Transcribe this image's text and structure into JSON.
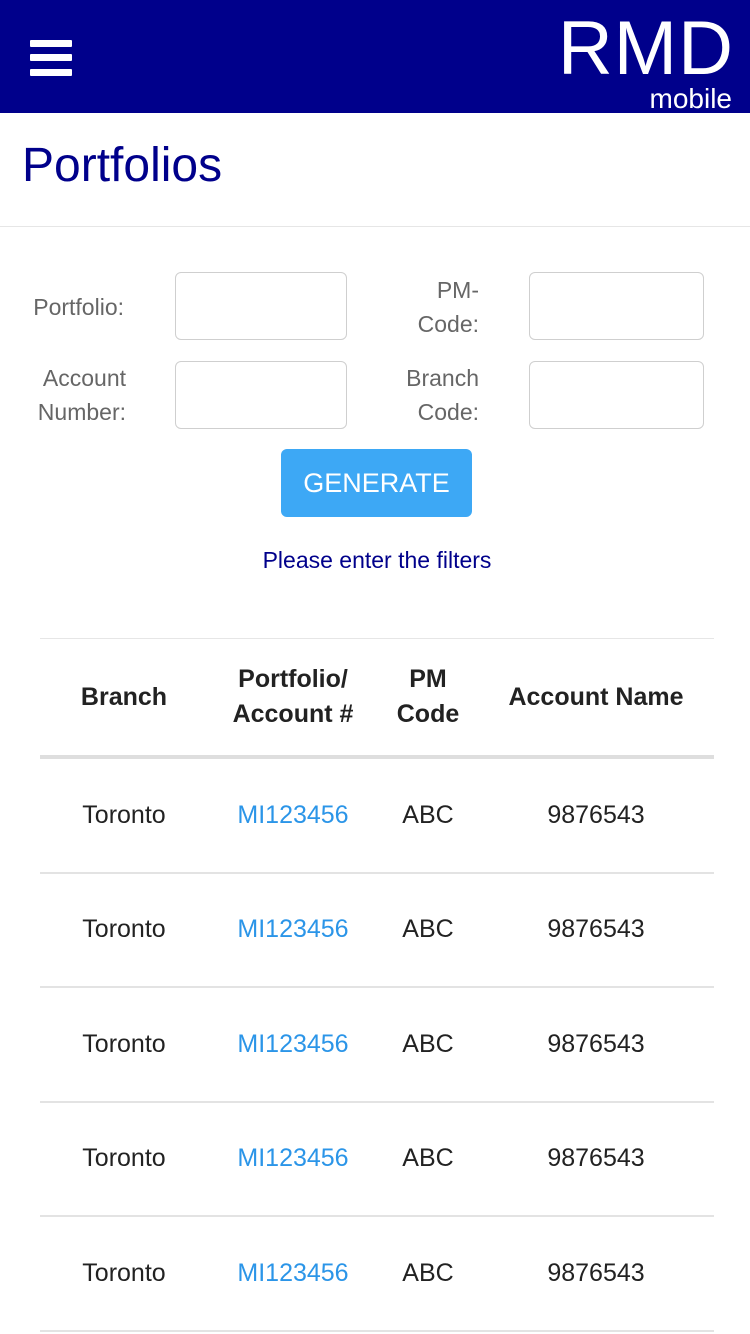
{
  "header": {
    "logo_main": "RMD",
    "logo_sub": "mobile",
    "bg_color": "#00008b"
  },
  "page": {
    "title": "Portfolios"
  },
  "filters": {
    "portfolio_label": "Portfolio:",
    "pm_code_label_line1": "PM-",
    "pm_code_label_line2": "Code:",
    "account_label_line1": "Account",
    "account_label_line2": "Number:",
    "branch_label_line1": "Branch",
    "branch_label_line2": "Code:",
    "portfolio_value": "",
    "pm_code_value": "",
    "account_value": "",
    "branch_value": "",
    "generate_label": "GENERATE",
    "hint": "Please enter the filters"
  },
  "table": {
    "headers": {
      "branch": "Branch",
      "portfolio_line1": "Portfolio/",
      "portfolio_line2": "Account #",
      "pm_line1": "PM",
      "pm_line2": "Code",
      "account_name": "Account Name"
    },
    "rows": [
      {
        "branch": "Toronto",
        "portfolio": "MI123456",
        "pm_code": "ABC",
        "account_name": "9876543"
      },
      {
        "branch": "Toronto",
        "portfolio": "MI123456",
        "pm_code": "ABC",
        "account_name": "9876543"
      },
      {
        "branch": "Toronto",
        "portfolio": "MI123456",
        "pm_code": "ABC",
        "account_name": "9876543"
      },
      {
        "branch": "Toronto",
        "portfolio": "MI123456",
        "pm_code": "ABC",
        "account_name": "9876543"
      },
      {
        "branch": "Toronto",
        "portfolio": "MI123456",
        "pm_code": "ABC",
        "account_name": "9876543"
      }
    ]
  },
  "colors": {
    "accent": "#3da8f5",
    "link": "#2b95e8",
    "title": "#00008b"
  }
}
